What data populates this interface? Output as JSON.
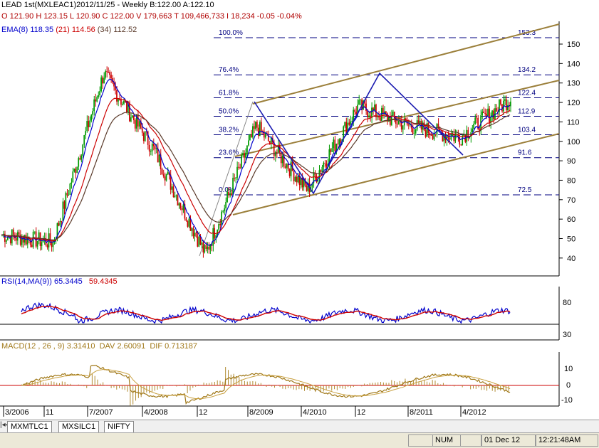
{
  "header": {
    "line1": "LEAD 1st(MXLEAC1)2012/11/25  - Weekly B:122.00  A:122.10",
    "line2": "O 121.90 H 123.15 L 120.90 C 122.00 V 179,663 T 109,466,733 I 18,234  -0.05  -0.04%",
    "ema_label": "EMA(8)",
    "ema8": "118.35",
    "ema21_label": "(21)",
    "ema21": "114.56",
    "ema34_label": "(34)",
    "ema34": "112.52"
  },
  "rsi": {
    "label": "RSI(14,MA(9))",
    "value": "65.3445",
    "ma": "59.4345",
    "levels": [
      "80",
      "30"
    ]
  },
  "macd": {
    "label": "MACD(12 , 26 , 9)",
    "macd": "3.31410",
    "dav_label": "DAV",
    "dav": "2.60091",
    "dif_label": "DIF",
    "dif": "0.713187",
    "levels": [
      "10",
      "0",
      "-10"
    ]
  },
  "price_axis": [
    "150",
    "140",
    "130",
    "120",
    "110",
    "100",
    "90",
    "80",
    "70",
    "60",
    "50",
    "40"
  ],
  "fib": {
    "percents": [
      "100.0%",
      "76.4%",
      "61.8%",
      "50.0%",
      "38.2%",
      "23.6%",
      "0.0%"
    ],
    "values": [
      "153.3",
      "134.2",
      "122.4",
      "112.9",
      "103.4",
      "91.6",
      "72.5"
    ]
  },
  "date_axis": [
    "3/2006",
    "11",
    "7/2007",
    "4/2008",
    "12",
    "8/2009",
    "4/2010",
    "12",
    "8/2011",
    "4/2012"
  ],
  "tabs": [
    "MXMTLC1",
    "MXSILC1",
    "NIFTY"
  ],
  "status": {
    "num": "NUM",
    "date": "01 Dec 12",
    "time": "12:21:48AM"
  },
  "colors": {
    "ema8": "#0000cc",
    "ema21": "#cc0000",
    "ema34": "#5a3a2a",
    "up": "#009900",
    "down": "#cc0000",
    "channel": "#9b7f3a",
    "fib": "#000080",
    "pattern": "#1a1ab0",
    "rsi": "#0000cc",
    "rsi_ma": "#cc0000",
    "macd": "#a07818",
    "dav": "#c8a040",
    "zero": "#cc0000"
  },
  "chart_data": [
    {
      "type": "candlestick",
      "x": [
        "3/2006",
        "11",
        "7/2007",
        "4/2008",
        "12",
        "8/2009",
        "4/2010",
        "12",
        "8/2011",
        "4/2012",
        "2012/11/25"
      ],
      "close": [
        52,
        48,
        135,
        95,
        42,
        108,
        75,
        118,
        108,
        102,
        122
      ],
      "ylim": [
        35,
        160
      ],
      "fib_levels": [
        153.3,
        134.2,
        122.4,
        112.9,
        103.4,
        91.6,
        72.5
      ],
      "series": [
        {
          "name": "EMA(8)",
          "last": 118.35
        },
        {
          "name": "(21)",
          "last": 114.56
        },
        {
          "name": "(34)",
          "last": 112.52
        }
      ]
    },
    {
      "type": "line",
      "series": [
        {
          "name": "RSI(14,MA(9))",
          "last": 65.3445
        },
        {
          "last": 59.4345
        }
      ],
      "levels": [
        80,
        30
      ]
    },
    {
      "type": "line",
      "series": [
        {
          "name": "MACD(12 , 26 , 9)",
          "last": 3.3141
        },
        {
          "name": "DAV",
          "last": 2.60091
        },
        {
          "name": "DIF",
          "last": 0.713187
        }
      ],
      "levels": [
        10,
        0,
        -10
      ]
    }
  ]
}
